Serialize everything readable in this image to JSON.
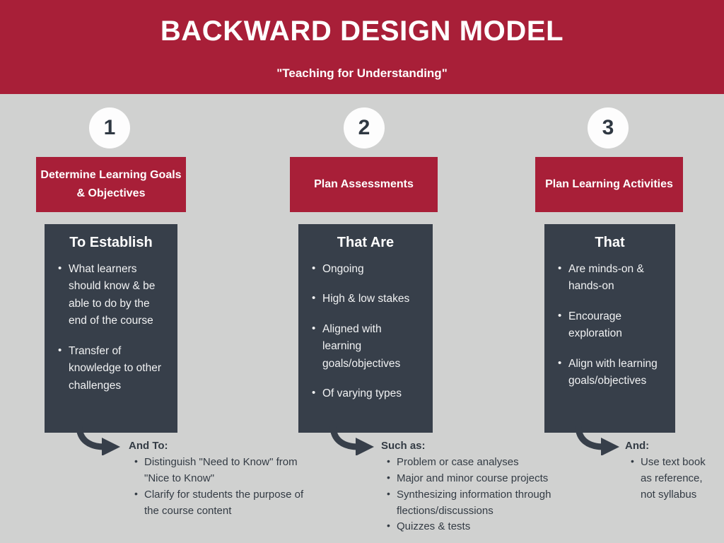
{
  "header": {
    "title": "BACKWARD DESIGN MODEL",
    "subtitle": "\"Teaching for Understanding\""
  },
  "colors": {
    "brand_red": "#a81f38",
    "dark_slate": "#373f4a",
    "background_gray": "#d0d1d0",
    "circle_white": "#fdfdfd",
    "body_text": "#333b44"
  },
  "steps": [
    {
      "number": "1",
      "title": "Determine Learning Goals & Objectives",
      "detail_heading": "To Establish",
      "detail_items": [
        "What learners should know & be able to do by the end of the course",
        "Transfer of knowledge to other challenges"
      ],
      "note_title": "And To:",
      "note_items": [
        "Distinguish \"Need to Know\" from \"Nice to Know\"",
        "Clarify for students the purpose of the course content"
      ]
    },
    {
      "number": "2",
      "title": "Plan Assessments",
      "detail_heading": "That Are",
      "detail_items": [
        "Ongoing",
        "High & low stakes",
        "Aligned with learning goals/objectives",
        "Of varying types"
      ],
      "note_title": "Such as:",
      "note_items": [
        "Problem or case analyses",
        "Major and minor course projects",
        "Synthesizing information through flections/discussions",
        "Quizzes & tests"
      ]
    },
    {
      "number": "3",
      "title": "Plan Learning Activities",
      "detail_heading": "That",
      "detail_items": [
        "Are minds-on & hands-on",
        "Encourage exploration",
        "Align with learning goals/objectives"
      ],
      "note_title": "And:",
      "note_items": [
        "Use text book as reference, not syllabus"
      ]
    }
  ]
}
